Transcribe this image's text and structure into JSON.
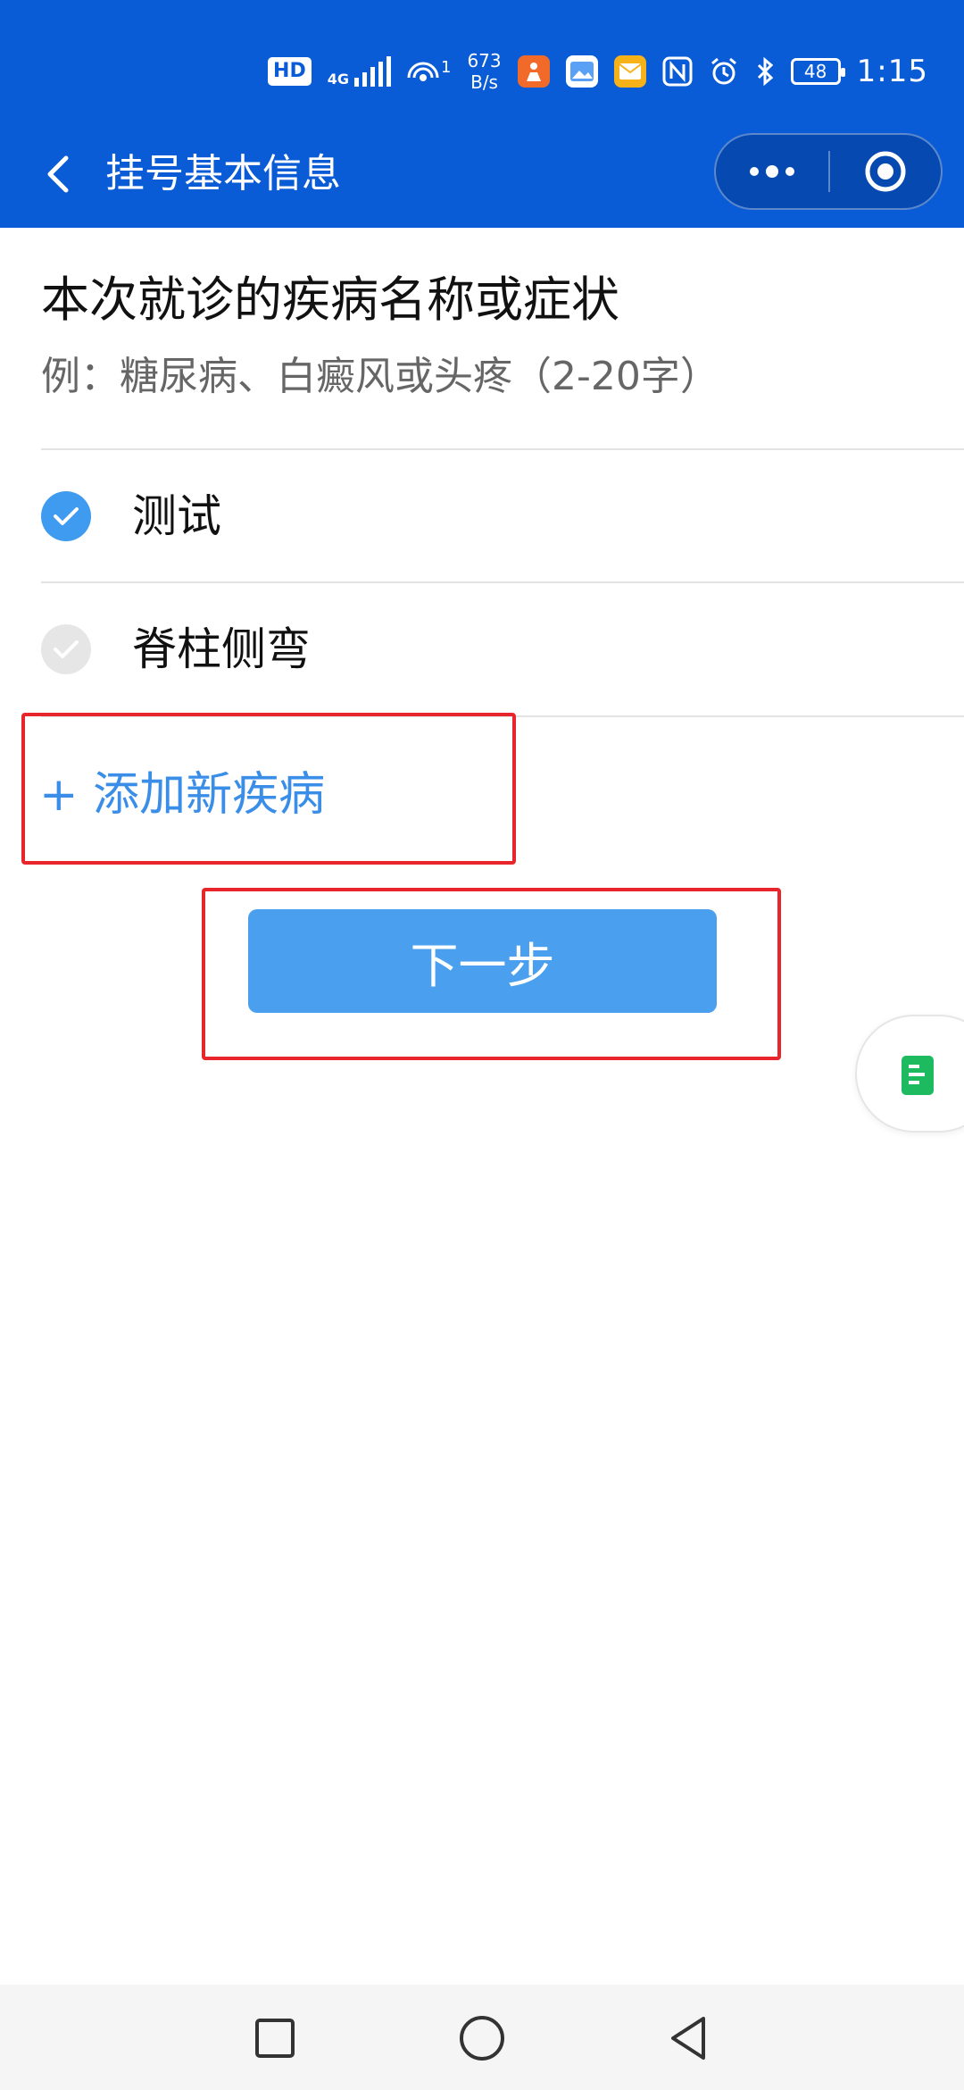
{
  "status_bar": {
    "hd": "HD",
    "network": "4G",
    "wifi_sup": "1",
    "speed_value": "673",
    "speed_unit": "B/s",
    "battery": "48",
    "time": "1:15"
  },
  "nav": {
    "title": "挂号基本信息",
    "back_icon": "chevron-left-icon",
    "more_icon": "more-dots-icon",
    "close_icon": "target-close-icon"
  },
  "form": {
    "question": "本次就诊的疾病名称或症状",
    "hint": "例：糖尿病、白癜风或头疼（2-20字）",
    "options": [
      {
        "label": "测试",
        "checked": true
      },
      {
        "label": "脊柱侧弯",
        "checked": false
      }
    ],
    "add_label": "+ 添加新疾病",
    "next_label": "下一步"
  },
  "colors": {
    "header": "#0a5bd6",
    "accent": "#3a8ee8",
    "button": "#4aa0ee",
    "highlight": "#e8252a"
  }
}
